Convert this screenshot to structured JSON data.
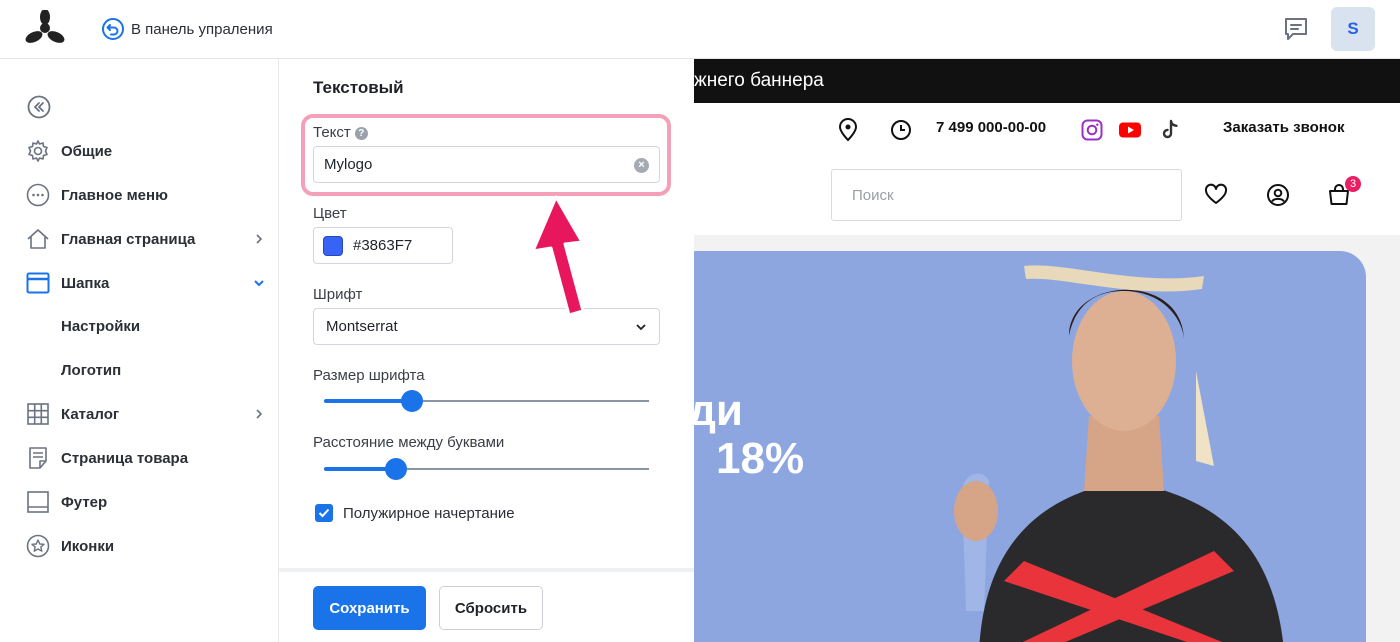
{
  "topbar": {
    "back_label": "В панель упраления",
    "avatar_initial": "S"
  },
  "sidebar": {
    "items": [
      {
        "label": "Общие",
        "icon": "gear-icon"
      },
      {
        "label": "Главное меню",
        "icon": "menu-dots-icon"
      },
      {
        "label": "Главная страница",
        "icon": "home-icon"
      },
      {
        "label": "Шапка",
        "icon": "header-layout-icon"
      },
      {
        "label": "Каталог",
        "icon": "grid-icon"
      },
      {
        "label": "Страница товара",
        "icon": "document-icon"
      },
      {
        "label": "Футер",
        "icon": "footer-layout-icon"
      },
      {
        "label": "Иконки",
        "icon": "star-icon"
      }
    ],
    "sub_items": [
      "Настройки",
      "Логотип"
    ],
    "active_color": "#1a73e8"
  },
  "panel": {
    "title": "Текстовый",
    "text_label": "Текст",
    "text_value": "Mylogo",
    "color_label": "Цвет",
    "color_value": "#3863F7",
    "font_label": "Шрифт",
    "font_value": "Montserrat",
    "font_size_label": "Размер шрифта",
    "font_size_fraction": 0.27,
    "letter_spacing_label": "Расстояние между буквами",
    "letter_spacing_fraction": 0.22,
    "bold_label": "Полужирное начертание",
    "bold_checked": true,
    "save_label": "Сохранить",
    "reset_label": "Сбросить"
  },
  "preview": {
    "top_banner_text": "жнего баннера",
    "phone": "7 499 000-00-00",
    "call_label": "Заказать звонок",
    "search_placeholder": "Поиск",
    "cart_count": "3",
    "banner_line1": "ди",
    "banner_line2": "18%"
  },
  "colors": {
    "accent": "#1a73e8",
    "highlight_border": "#f3a0b8",
    "arrow": "#e8175d",
    "banner_bg": "#8ea6e0"
  }
}
